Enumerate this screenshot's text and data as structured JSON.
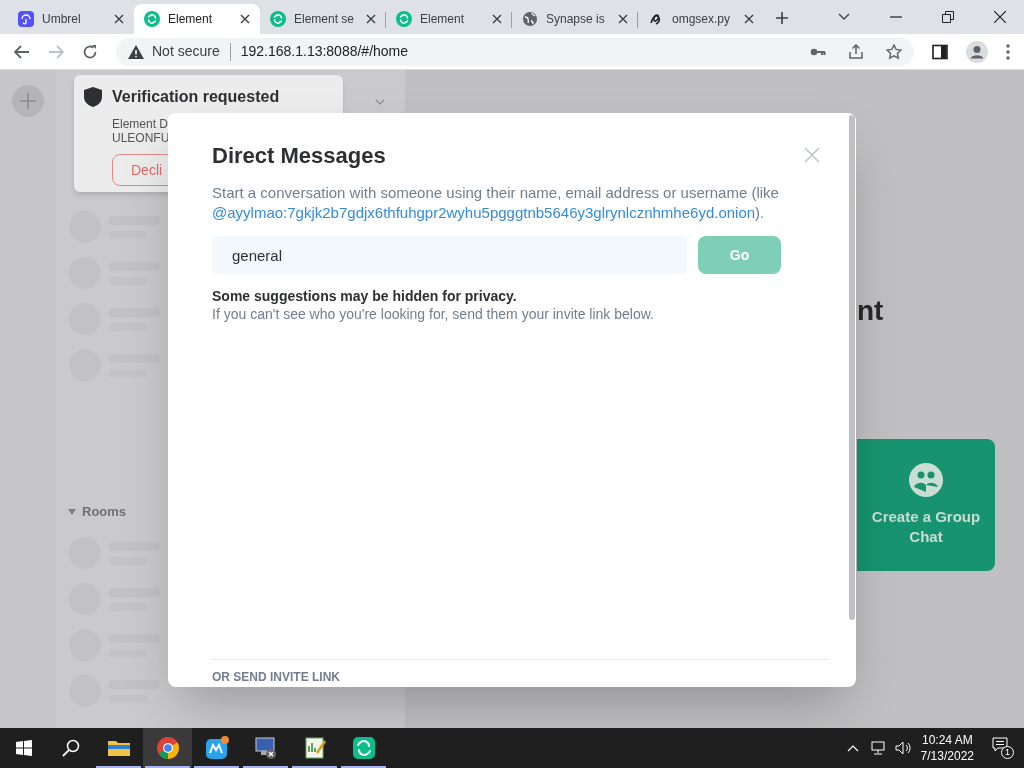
{
  "browser": {
    "tabs": [
      {
        "title": "Umbrel",
        "kind": "umbrel",
        "selected": false
      },
      {
        "title": "Element",
        "kind": "element",
        "selected": true
      },
      {
        "title": "Element se",
        "kind": "element",
        "selected": false
      },
      {
        "title": "Element",
        "kind": "element",
        "selected": false
      },
      {
        "title": "Synapse is",
        "kind": "globe",
        "selected": false
      },
      {
        "title": "omgsex.py",
        "kind": "script",
        "selected": false
      }
    ],
    "security": "Not secure",
    "url": "192.168.1.13:8088/#/home"
  },
  "app": {
    "sidebar": {
      "rooms_heading": "Rooms"
    },
    "toast": {
      "title": "Verification requested",
      "line_1": "Element D",
      "line_2": "ULEONFU",
      "button": "Decli"
    },
    "main": {
      "heading_fragment": "nt",
      "group_chat_button": "Create a Group Chat"
    }
  },
  "dialog": {
    "title": "Direct Messages",
    "description_before": "Start a conversation with someone using their name, email address or username (like ",
    "description_link": "@ayylmao:7gkjk2b7gdjx6thfuhgpr2wyhu5pgggtnb5646y3glrynlcznhmhe6yd.onion",
    "description_after": ").",
    "search_value": "general",
    "go_button": {
      "label": "Go",
      "disabled": true
    },
    "privacy_title": "Some suggestions may be hidden for privacy.",
    "privacy_text": "If you can't see who you're looking for, send them your invite link below.",
    "invite_heading": "OR SEND INVITE LINK"
  },
  "taskbar": {
    "apps": [
      {
        "kind": "files",
        "selected": false
      },
      {
        "kind": "chrome",
        "selected": true
      },
      {
        "kind": "notes",
        "selected": false
      },
      {
        "kind": "network",
        "selected": false
      },
      {
        "kind": "editor",
        "selected": false
      },
      {
        "kind": "element",
        "selected": false
      }
    ],
    "time": "10:24 AM",
    "date": "7/13/2022",
    "notification_count": "1"
  }
}
